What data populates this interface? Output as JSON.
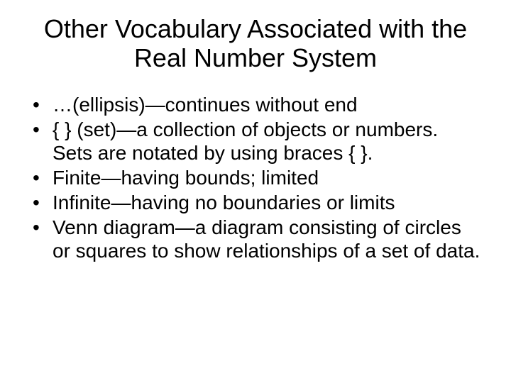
{
  "title": "Other Vocabulary Associated with the Real Number System",
  "bullets": [
    "…(ellipsis)—continues without end",
    "{ } (set)—a collection of objects or numbers.  Sets are notated by using braces { }.",
    "Finite—having bounds; limited",
    "Infinite—having no boundaries or limits",
    "Venn diagram—a diagram consisting of circles or squares to show relationships of a set of data."
  ]
}
